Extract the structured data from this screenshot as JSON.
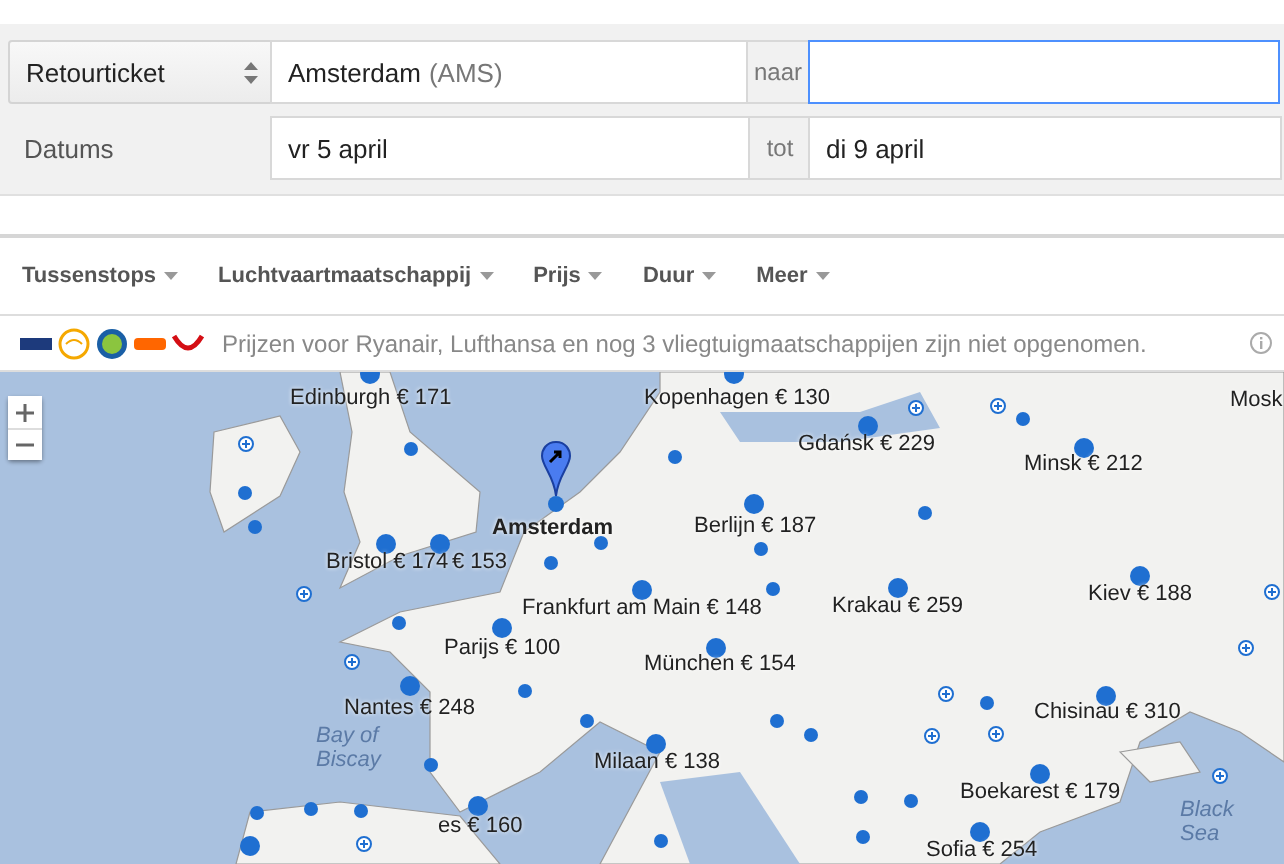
{
  "search": {
    "trip_type": "Retourticket",
    "origin": "Amsterdam",
    "origin_code": "(AMS)",
    "to_label": "naar",
    "destination": {
      "focused": true
    },
    "dates_label": "Datums",
    "depart": "vr 5 april",
    "until_label": "tot",
    "return": "di 9 april"
  },
  "filters": [
    {
      "label": "Tussenstops"
    },
    {
      "label": "Luchtvaartmaatschappij"
    },
    {
      "label": "Prijs"
    },
    {
      "label": "Duur"
    },
    {
      "label": "Meer"
    }
  ],
  "notice": "Prijzen voor Ryanair, Lufthansa en nog 3 vliegtuigmaatschappijen zijn niet opgenomen.",
  "map": {
    "origin": "Amsterdam",
    "labels": [
      {
        "text": "Edinburgh € 171",
        "kind": "city"
      },
      {
        "text": "Kopenhagen € 130",
        "kind": "city"
      },
      {
        "text": "Gdańsk € 229",
        "kind": "city"
      },
      {
        "text": "Minsk € 212",
        "kind": "city"
      },
      {
        "text": "Mosk",
        "kind": "city"
      },
      {
        "text": "Berlijn € 187",
        "kind": "city"
      },
      {
        "text": "Bristol € 174",
        "kind": "city"
      },
      {
        "text": "€ 153",
        "kind": "city"
      },
      {
        "text": "Kiev € 188",
        "kind": "city"
      },
      {
        "text": "Frankfurt am Main € 148",
        "kind": "city"
      },
      {
        "text": "Krakau € 259",
        "kind": "city"
      },
      {
        "text": "Parijs € 100",
        "kind": "city"
      },
      {
        "text": "München € 154",
        "kind": "city"
      },
      {
        "text": "Nantes € 248",
        "kind": "city"
      },
      {
        "text": "Chisinau € 310",
        "kind": "city"
      },
      {
        "text": "Bay of Biscay",
        "kind": "sea"
      },
      {
        "text": "Milaan € 138",
        "kind": "city"
      },
      {
        "text": "Boekarest € 179",
        "kind": "city"
      },
      {
        "text": "Black Sea",
        "kind": "sea"
      },
      {
        "text": "es € 160",
        "kind": "city"
      },
      {
        "text": "Sofia € 254",
        "kind": "city"
      }
    ]
  }
}
